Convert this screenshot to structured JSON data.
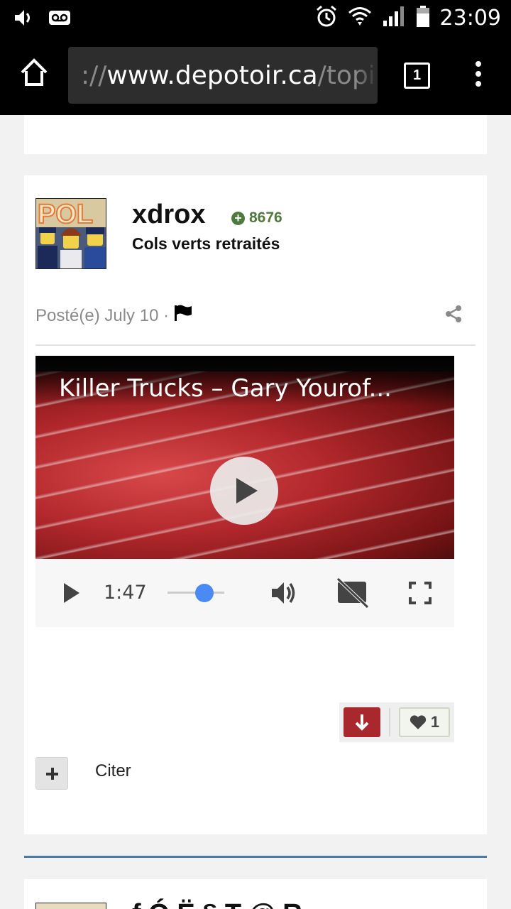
{
  "status_bar": {
    "time": "23:09",
    "icons": [
      "volume-icon",
      "voicemail-icon",
      "alarm-icon",
      "wifi-icon",
      "signal-icon",
      "battery-icon"
    ]
  },
  "browser": {
    "url_scheme": "://",
    "url_host": "www.depotoir.ca",
    "url_path": "/topi",
    "tab_count": "1"
  },
  "post": {
    "username": "xdrox",
    "reputation": "8676",
    "group": "Cols verts retraités",
    "date": "Posté(e) July 10 ·",
    "video": {
      "title": "Killer Trucks – Gary Yourof...",
      "time": "1:47"
    },
    "like_count": "1",
    "quote_label": "Citer"
  },
  "next_post": {
    "username_partial": "f Ó Ë § T @ R"
  },
  "colors": {
    "reputation": "#4e7a3e",
    "downvote": "#a8282e",
    "slider_knob": "#4a8af4",
    "divider_blue": "#4a7ba5"
  }
}
